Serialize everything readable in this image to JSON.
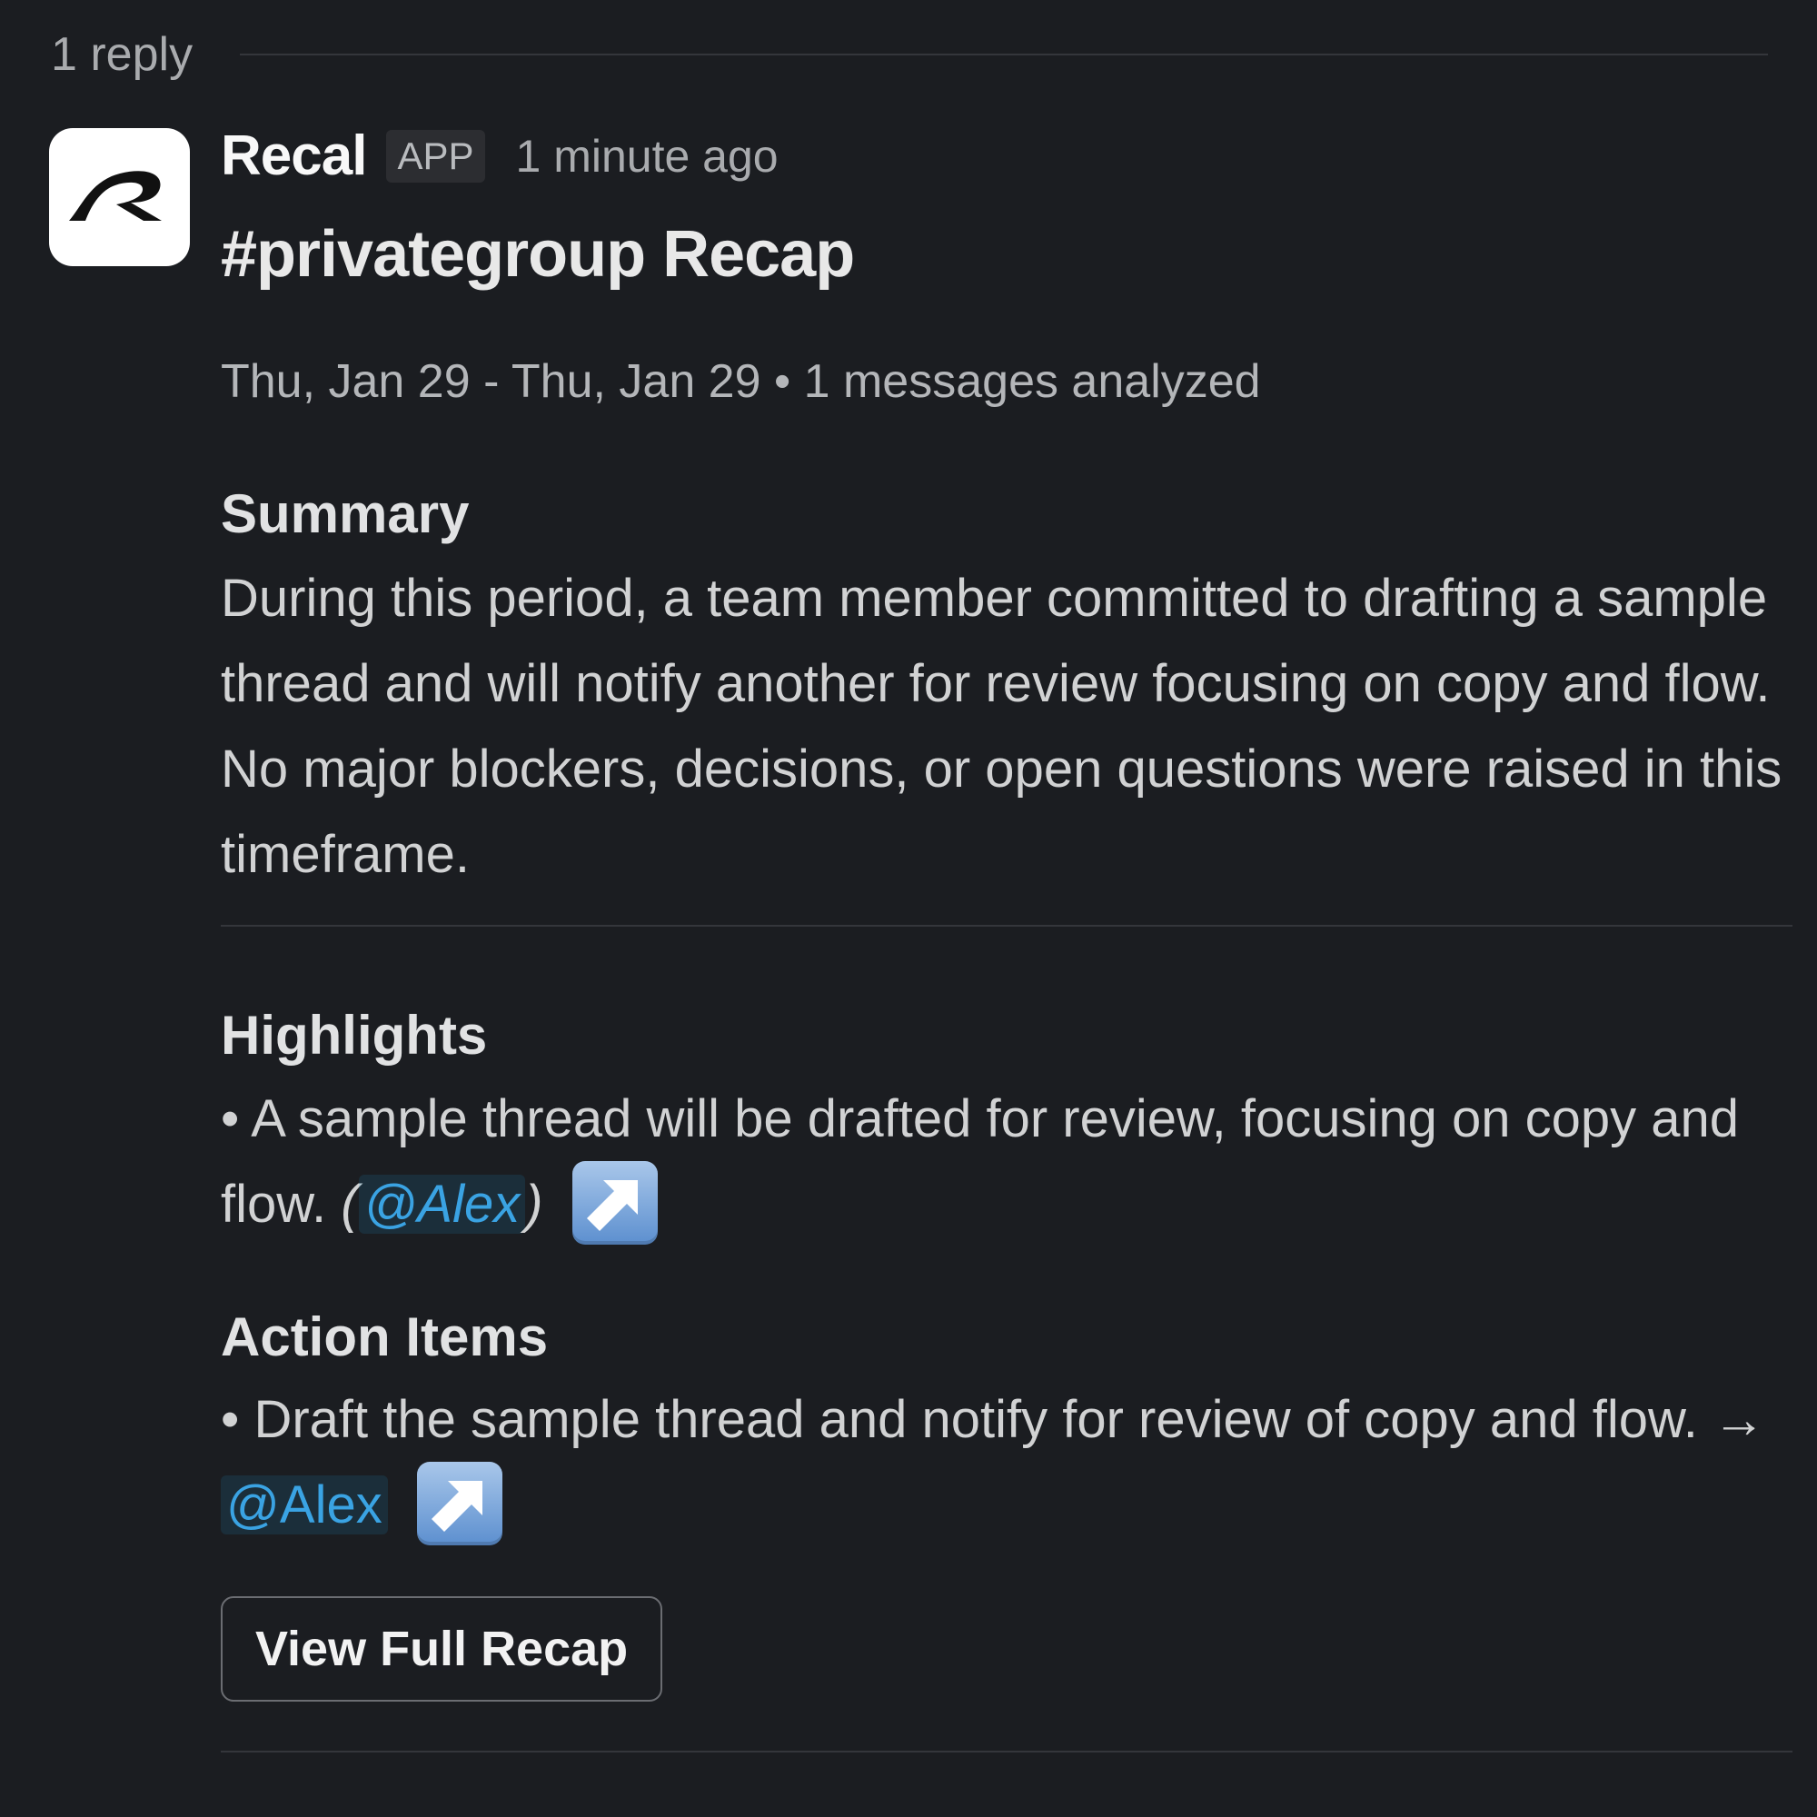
{
  "thread": {
    "reply_count": "1 reply"
  },
  "message": {
    "app_name": "Recal",
    "app_badge": "APP",
    "timestamp": "1 minute ago",
    "title": "#privategroup Recap",
    "date_range": "Thu, Jan 29 - Thu, Jan 29 • 1 messages analyzed"
  },
  "summary": {
    "heading": "Summary",
    "text": "During this period, a team member committed to drafting a sample thread and will notify another for review focusing on copy and flow. No major blockers, decisions, or open questions were raised in this timeframe."
  },
  "highlights": {
    "heading": "Highlights",
    "items": [
      {
        "bullet": "•",
        "text": "A sample thread will be drafted for review, focusing on copy and flow.",
        "paren_open": "(",
        "mention": "@Alex",
        "paren_close": ")",
        "link_icon": "arrow-up-right-icon"
      }
    ]
  },
  "action_items": {
    "heading": "Action Items",
    "items": [
      {
        "bullet": "•",
        "text": "Draft the sample thread and notify for review of copy and flow.",
        "arrow": "→",
        "mention": "@Alex",
        "link_icon": "arrow-up-right-icon"
      }
    ]
  },
  "buttons": {
    "view_full_recap": "View Full Recap"
  },
  "colors": {
    "background": "#1b1d21",
    "mention": "#3aa3e3",
    "link_icon": "#7aa6dc"
  }
}
